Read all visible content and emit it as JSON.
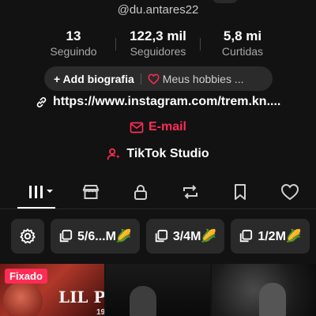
{
  "profile": {
    "username": "@du.antares22",
    "stats": [
      {
        "value": "13",
        "label": "Seguindo"
      },
      {
        "value": "122,3 mil",
        "label": "Seguidores"
      },
      {
        "value": "5,8 mi",
        "label": "Curtidas"
      }
    ],
    "add_bio_label": "+ Add biografia",
    "hobbies_label": "Meus hobbies ...",
    "link": "https://www.instagram.com/trem.kn....",
    "email_label": "E-mail",
    "studio_label": "TikTok Studio"
  },
  "tabs": [
    {
      "icon": "grid-icon",
      "active": true
    },
    {
      "icon": "shop-icon",
      "active": false
    },
    {
      "icon": "lock-icon",
      "active": false
    },
    {
      "icon": "repost-icon",
      "active": false
    },
    {
      "icon": "bookmark-icon",
      "active": false
    },
    {
      "icon": "heart-icon",
      "active": false
    }
  ],
  "collections": [
    {
      "label": "5/6...M🌽"
    },
    {
      "label": "3/4M🌽"
    },
    {
      "label": "1/2M🌽"
    }
  ],
  "videos": [
    {
      "badge": "Fixado",
      "poster_title": "LIL P",
      "poster_number": "19"
    },
    {},
    {}
  ],
  "colors": {
    "accent": "#fe2c55",
    "background": "#121212",
    "chip": "#2a2a2a"
  }
}
